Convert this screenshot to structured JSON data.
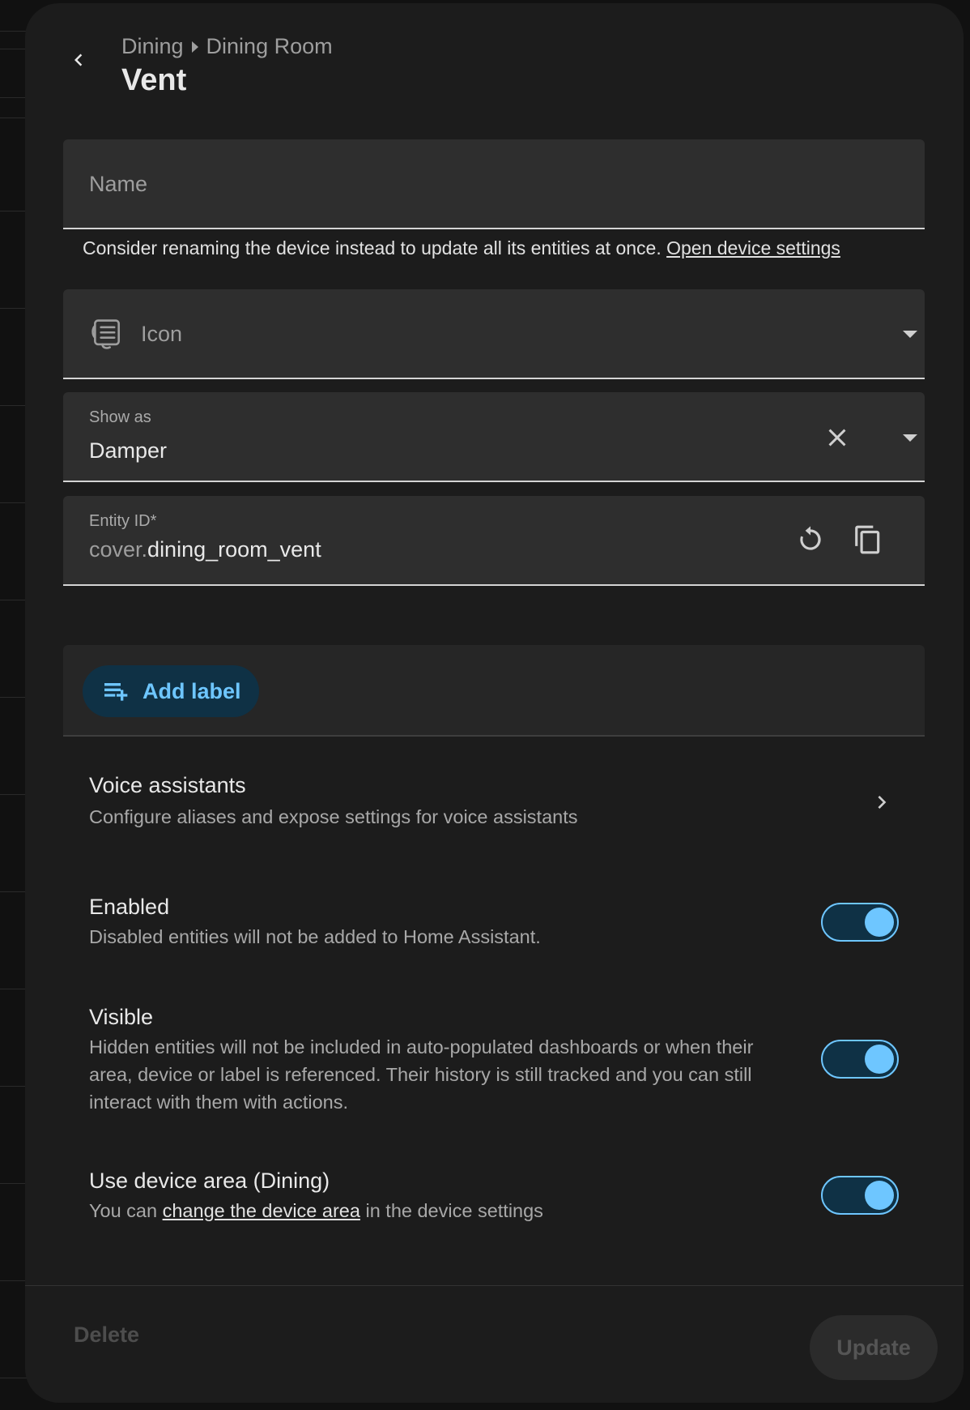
{
  "header": {
    "breadcrumb": [
      "Dining",
      "Dining Room"
    ],
    "title": "Vent"
  },
  "name_field": {
    "placeholder": "Name",
    "helper_text": "Consider renaming the device instead to update all its entities at once.",
    "helper_link": "Open device settings"
  },
  "icon_field": {
    "placeholder": "Icon",
    "icon": "air-vent-icon"
  },
  "show_as_field": {
    "label": "Show as",
    "value": "Damper"
  },
  "entity_id_field": {
    "label": "Entity ID*",
    "prefix": "cover.",
    "value": "dining_room_vent"
  },
  "labels": {
    "add_label": "Add label"
  },
  "voice_assistants": {
    "title": "Voice assistants",
    "description": "Configure aliases and expose settings for voice assistants"
  },
  "enabled": {
    "title": "Enabled",
    "description": "Disabled entities will not be added to Home Assistant.",
    "on": true
  },
  "visible": {
    "title": "Visible",
    "description": "Hidden entities will not be included in auto-populated dashboards or when their area, device or label is referenced. Their history is still tracked and you can still interact with them with actions.",
    "on": true
  },
  "device_area": {
    "title": "Use device area (Dining)",
    "desc_before": "You can",
    "desc_link": "change the device area",
    "desc_after": "in the device settings",
    "on": true
  },
  "footer": {
    "delete_label": "Delete",
    "update_label": "Update"
  },
  "colors": {
    "accent": "#6ec6ff",
    "surface": "#1c1c1c",
    "field": "#2e2e2e"
  }
}
